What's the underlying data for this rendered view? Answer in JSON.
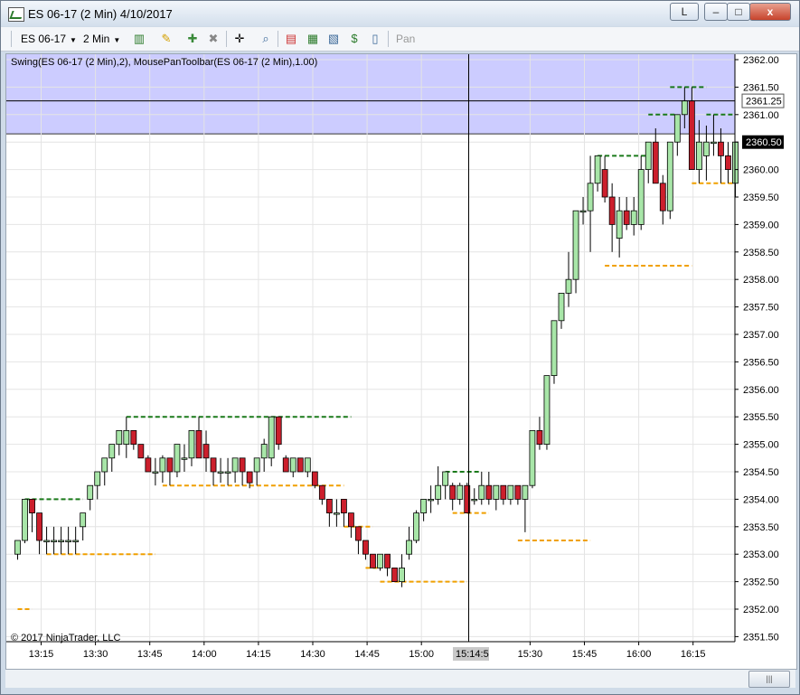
{
  "window": {
    "title": "ES 06-17 (2 Min)  4/10/2017",
    "link_button": "L",
    "minimize": "–",
    "maximize": "□",
    "close": "x"
  },
  "toolbar": {
    "instrument": "ES 06-17",
    "interval": "2 Min",
    "pan_label": "Pan"
  },
  "chart": {
    "indicator_label": "Swing(ES 06-17 (2 Min),2), MousePanToolbar(ES 06-17 (2 Min),1.00)",
    "copyright": "© 2017 NinjaTrader, LLC",
    "crosshair_time": "15:14:5",
    "crosshair_price": "2361.25",
    "last_price": "2360.50",
    "colors": {
      "up": "#a8e6a8",
      "down": "#cc1f2c",
      "shade": "#ccccff",
      "swing_high": "#1a7a1a",
      "swing_low": "#f0a000"
    }
  },
  "chart_data": {
    "type": "candlestick",
    "y_ticks": [
      "2362.00",
      "2361.50",
      "2361.00",
      "2360.50",
      "2360.00",
      "2359.50",
      "2359.00",
      "2358.50",
      "2358.00",
      "2357.50",
      "2357.00",
      "2356.50",
      "2356.00",
      "2355.50",
      "2355.00",
      "2354.50",
      "2354.00",
      "2353.50",
      "2353.00",
      "2352.50",
      "2352.00",
      "2351.50"
    ],
    "x_ticks": [
      "13:15",
      "13:30",
      "13:45",
      "14:00",
      "14:15",
      "14:30",
      "14:45",
      "15:00",
      "15:30",
      "15:45",
      "16:00",
      "16:15"
    ],
    "ylim": [
      2351.4,
      2362.2
    ],
    "shaded_zone": [
      2360.65,
      2362.2
    ],
    "candles": [
      [
        2353.0,
        2353.25,
        2352.9,
        2353.25
      ],
      [
        2353.25,
        2354.0,
        2353.2,
        2354.0
      ],
      [
        2354.0,
        2354.0,
        2353.4,
        2353.75
      ],
      [
        2353.75,
        2353.75,
        2353.0,
        2353.25
      ],
      [
        2353.25,
        2353.5,
        2353.0,
        2353.25
      ],
      [
        2353.25,
        2353.5,
        2353.0,
        2353.25
      ],
      [
        2353.25,
        2353.5,
        2353.0,
        2353.25
      ],
      [
        2353.25,
        2353.5,
        2353.0,
        2353.25
      ],
      [
        2353.25,
        2353.5,
        2353.0,
        2353.25
      ],
      [
        2353.5,
        2353.75,
        2353.25,
        2353.75
      ],
      [
        2354.0,
        2354.25,
        2353.8,
        2354.25
      ],
      [
        2354.25,
        2354.5,
        2354.0,
        2354.5
      ],
      [
        2354.5,
        2354.75,
        2354.25,
        2354.75
      ],
      [
        2354.75,
        2355.0,
        2354.5,
        2355.0
      ],
      [
        2355.0,
        2355.25,
        2354.8,
        2355.25
      ],
      [
        2355.0,
        2355.5,
        2354.75,
        2355.25
      ],
      [
        2355.25,
        2355.25,
        2354.9,
        2355.0
      ],
      [
        2355.0,
        2355.0,
        2354.75,
        2354.75
      ],
      [
        2354.75,
        2354.8,
        2354.5,
        2354.5
      ],
      [
        2354.5,
        2354.75,
        2354.25,
        2354.5
      ],
      [
        2354.5,
        2354.8,
        2354.3,
        2354.75
      ],
      [
        2354.75,
        2354.75,
        2354.25,
        2354.5
      ],
      [
        2354.5,
        2355.0,
        2354.4,
        2355.0
      ],
      [
        2354.75,
        2355.0,
        2354.5,
        2354.75
      ],
      [
        2354.75,
        2355.25,
        2354.6,
        2355.25
      ],
      [
        2355.25,
        2355.5,
        2354.75,
        2354.75
      ],
      [
        2355.0,
        2355.25,
        2354.5,
        2354.75
      ],
      [
        2354.75,
        2354.75,
        2354.25,
        2354.5
      ],
      [
        2354.5,
        2354.75,
        2354.3,
        2354.5
      ],
      [
        2354.5,
        2354.75,
        2354.25,
        2354.5
      ],
      [
        2354.5,
        2354.75,
        2354.3,
        2354.75
      ],
      [
        2354.75,
        2354.75,
        2354.25,
        2354.5
      ],
      [
        2354.5,
        2354.5,
        2354.2,
        2354.3
      ],
      [
        2354.5,
        2354.75,
        2354.25,
        2354.75
      ],
      [
        2354.75,
        2355.1,
        2354.5,
        2355.0
      ],
      [
        2354.75,
        2355.5,
        2354.6,
        2355.5
      ],
      [
        2355.5,
        2355.5,
        2354.9,
        2355.0
      ],
      [
        2354.75,
        2354.8,
        2354.5,
        2354.5
      ],
      [
        2354.5,
        2354.75,
        2354.4,
        2354.75
      ],
      [
        2354.75,
        2354.75,
        2354.5,
        2354.5
      ],
      [
        2354.5,
        2354.75,
        2354.4,
        2354.75
      ],
      [
        2354.5,
        2354.5,
        2354.2,
        2354.25
      ],
      [
        2354.25,
        2354.25,
        2353.9,
        2354.0
      ],
      [
        2354.0,
        2354.0,
        2353.5,
        2353.75
      ],
      [
        2353.75,
        2354.0,
        2353.5,
        2353.75
      ],
      [
        2354.0,
        2354.0,
        2353.5,
        2353.75
      ],
      [
        2353.75,
        2353.75,
        2353.3,
        2353.5
      ],
      [
        2353.5,
        2353.5,
        2353.0,
        2353.25
      ],
      [
        2353.25,
        2353.25,
        2352.9,
        2353.0
      ],
      [
        2353.0,
        2353.0,
        2352.75,
        2352.75
      ],
      [
        2352.75,
        2353.0,
        2352.7,
        2353.0
      ],
      [
        2353.0,
        2353.0,
        2352.6,
        2352.75
      ],
      [
        2352.75,
        2352.75,
        2352.5,
        2352.5
      ],
      [
        2352.5,
        2353.0,
        2352.4,
        2352.75
      ],
      [
        2353.0,
        2353.5,
        2352.9,
        2353.25
      ],
      [
        2353.25,
        2353.8,
        2353.2,
        2353.75
      ],
      [
        2353.75,
        2354.0,
        2353.6,
        2354.0
      ],
      [
        2354.0,
        2354.25,
        2353.75,
        2354.0
      ],
      [
        2354.0,
        2354.6,
        2353.9,
        2354.25
      ],
      [
        2354.25,
        2354.5,
        2354.0,
        2354.5
      ],
      [
        2354.25,
        2354.3,
        2353.8,
        2354.0
      ],
      [
        2354.0,
        2354.3,
        2353.9,
        2354.25
      ],
      [
        2354.25,
        2354.3,
        2353.75,
        2353.75
      ],
      [
        2354.0,
        2354.2,
        2353.9,
        2354.0
      ],
      [
        2354.0,
        2354.5,
        2353.9,
        2354.25
      ],
      [
        2354.25,
        2354.5,
        2353.9,
        2354.0
      ],
      [
        2354.0,
        2354.25,
        2353.8,
        2354.25
      ],
      [
        2354.25,
        2354.25,
        2353.9,
        2354.0
      ],
      [
        2354.0,
        2354.25,
        2353.9,
        2354.25
      ],
      [
        2354.25,
        2354.25,
        2353.9,
        2354.0
      ],
      [
        2354.0,
        2354.25,
        2353.4,
        2354.25
      ],
      [
        2354.25,
        2355.25,
        2354.2,
        2355.25
      ],
      [
        2355.25,
        2355.5,
        2354.9,
        2355.0
      ],
      [
        2355.0,
        2356.25,
        2354.9,
        2356.25
      ],
      [
        2356.25,
        2357.25,
        2356.1,
        2357.25
      ],
      [
        2357.25,
        2357.75,
        2357.1,
        2357.75
      ],
      [
        2357.75,
        2358.5,
        2357.5,
        2358.0
      ],
      [
        2358.0,
        2359.25,
        2357.75,
        2359.25
      ],
      [
        2359.25,
        2359.5,
        2359.0,
        2359.25
      ],
      [
        2359.25,
        2360.25,
        2358.5,
        2359.75
      ],
      [
        2359.75,
        2360.25,
        2359.6,
        2360.25
      ],
      [
        2360.0,
        2360.25,
        2359.4,
        2359.5
      ],
      [
        2359.5,
        2359.75,
        2358.5,
        2359.0
      ],
      [
        2358.75,
        2359.5,
        2358.4,
        2359.25
      ],
      [
        2359.25,
        2359.5,
        2358.9,
        2359.0
      ],
      [
        2359.0,
        2359.5,
        2358.8,
        2359.25
      ],
      [
        2359.0,
        2360.25,
        2358.9,
        2360.0
      ],
      [
        2360.0,
        2360.5,
        2359.75,
        2360.5
      ],
      [
        2360.5,
        2360.75,
        2359.8,
        2359.75
      ],
      [
        2359.75,
        2359.9,
        2359.0,
        2359.25
      ],
      [
        2359.25,
        2360.5,
        2359.1,
        2360.5
      ],
      [
        2360.5,
        2361.0,
        2360.25,
        2361.0
      ],
      [
        2361.0,
        2361.5,
        2360.75,
        2361.25
      ],
      [
        2361.25,
        2361.5,
        2360.0,
        2360.0
      ],
      [
        2360.0,
        2360.9,
        2359.75,
        2360.5
      ],
      [
        2360.25,
        2360.8,
        2359.8,
        2360.5
      ],
      [
        2360.5,
        2361.0,
        2360.25,
        2360.5
      ],
      [
        2360.5,
        2360.75,
        2359.75,
        2360.25
      ],
      [
        2360.25,
        2360.5,
        2359.75,
        2360.0
      ],
      [
        2359.75,
        2360.5,
        2359.5,
        2360.5
      ]
    ],
    "swing_highs": [
      [
        1,
        9,
        2354.0
      ],
      [
        15,
        46,
        2355.5
      ],
      [
        59,
        64,
        2354.5
      ],
      [
        80,
        87,
        2360.25
      ],
      [
        87,
        91,
        2361.0
      ],
      [
        90,
        95,
        2361.5
      ],
      [
        95,
        99,
        2361.0
      ]
    ],
    "swing_lows": [
      [
        0,
        2,
        2352.0
      ],
      [
        4,
        19,
        2353.0
      ],
      [
        20,
        45,
        2354.25
      ],
      [
        45,
        49,
        2353.5
      ],
      [
        48,
        50,
        2352.75
      ],
      [
        50,
        62,
        2352.5
      ],
      [
        60,
        65,
        2353.75
      ],
      [
        69,
        79,
        2353.25
      ],
      [
        81,
        93,
        2358.25
      ],
      [
        93,
        99,
        2359.75
      ]
    ]
  }
}
